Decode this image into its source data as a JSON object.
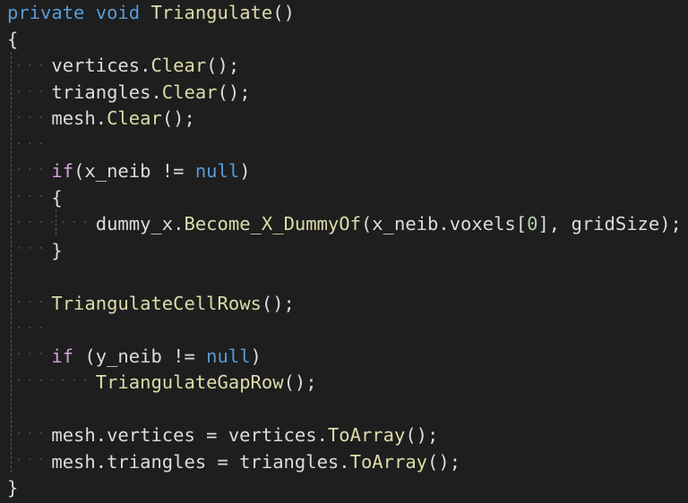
{
  "editor": {
    "colors": {
      "background": "#1e1e1e",
      "keyword": "#569cd6",
      "control_keyword": "#d8a0df",
      "method": "#dcdcaa",
      "number": "#b5cea8",
      "text": "#dcdcdc"
    },
    "lines": [
      {
        "tokens": [
          {
            "t": "private",
            "c": "kw"
          },
          {
            "t": " ",
            "c": "txt"
          },
          {
            "t": "void",
            "c": "kw"
          },
          {
            "t": " ",
            "c": "txt"
          },
          {
            "t": "Triangulate",
            "c": "meth"
          },
          {
            "t": "()",
            "c": "txt"
          }
        ]
      },
      {
        "tokens": [
          {
            "t": "{",
            "c": "txt"
          }
        ]
      },
      {
        "tokens": [
          {
            "t": "    vertices.",
            "c": "txt"
          },
          {
            "t": "Clear",
            "c": "meth"
          },
          {
            "t": "();",
            "c": "txt"
          }
        ]
      },
      {
        "tokens": [
          {
            "t": "    triangles.",
            "c": "txt"
          },
          {
            "t": "Clear",
            "c": "meth"
          },
          {
            "t": "();",
            "c": "txt"
          }
        ]
      },
      {
        "tokens": [
          {
            "t": "    mesh.",
            "c": "txt"
          },
          {
            "t": "Clear",
            "c": "meth"
          },
          {
            "t": "();",
            "c": "txt"
          }
        ]
      },
      {
        "tokens": []
      },
      {
        "tokens": [
          {
            "t": "    ",
            "c": "txt"
          },
          {
            "t": "if",
            "c": "ctl"
          },
          {
            "t": "(x_neib != ",
            "c": "txt"
          },
          {
            "t": "null",
            "c": "kw"
          },
          {
            "t": ")",
            "c": "txt"
          }
        ]
      },
      {
        "tokens": [
          {
            "t": "    {",
            "c": "txt"
          }
        ]
      },
      {
        "tokens": [
          {
            "t": "        dummy_x.",
            "c": "txt"
          },
          {
            "t": "Become_X_DummyOf",
            "c": "meth"
          },
          {
            "t": "(x_neib.voxels[",
            "c": "txt"
          },
          {
            "t": "0",
            "c": "num"
          },
          {
            "t": "], gridSize);",
            "c": "txt"
          }
        ]
      },
      {
        "tokens": [
          {
            "t": "    }",
            "c": "txt"
          }
        ]
      },
      {
        "tokens": []
      },
      {
        "tokens": [
          {
            "t": "    ",
            "c": "txt"
          },
          {
            "t": "TriangulateCellRows",
            "c": "meth"
          },
          {
            "t": "();",
            "c": "txt"
          }
        ]
      },
      {
        "tokens": []
      },
      {
        "tokens": [
          {
            "t": "    ",
            "c": "txt"
          },
          {
            "t": "if",
            "c": "ctl"
          },
          {
            "t": " (y_neib != ",
            "c": "txt"
          },
          {
            "t": "null",
            "c": "kw"
          },
          {
            "t": ")",
            "c": "txt"
          }
        ]
      },
      {
        "tokens": [
          {
            "t": "        ",
            "c": "txt"
          },
          {
            "t": "TriangulateGapRow",
            "c": "meth"
          },
          {
            "t": "();",
            "c": "txt"
          }
        ]
      },
      {
        "tokens": []
      },
      {
        "tokens": [
          {
            "t": "    mesh.vertices = vertices.",
            "c": "txt"
          },
          {
            "t": "ToArray",
            "c": "meth"
          },
          {
            "t": "();",
            "c": "txt"
          }
        ]
      },
      {
        "tokens": [
          {
            "t": "    mesh.triangles = triangles.",
            "c": "txt"
          },
          {
            "t": "ToArray",
            "c": "meth"
          },
          {
            "t": "();",
            "c": "txt"
          }
        ]
      },
      {
        "tokens": [
          {
            "t": "}",
            "c": "txt"
          }
        ]
      }
    ]
  }
}
